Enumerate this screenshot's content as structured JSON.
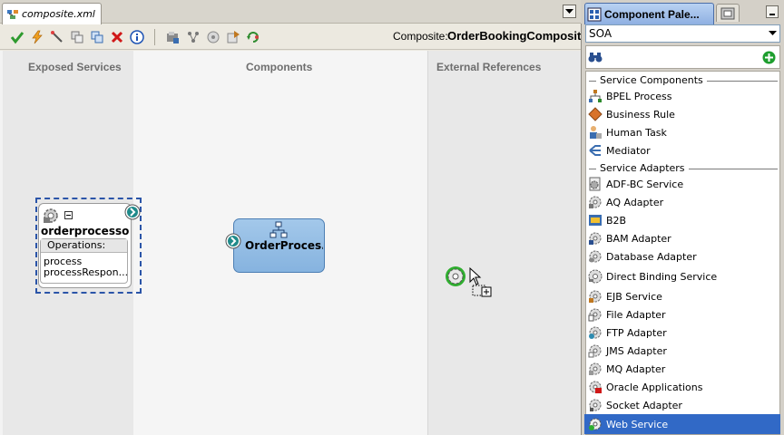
{
  "editor": {
    "tab_label": "composite.xml",
    "composite_label": "Composite:",
    "composite_name": "OrderBookingComposite",
    "toolbar_icons": [
      "validate-check-icon",
      "lightning-icon",
      "wand-icon",
      "copy-icon",
      "paste-icon",
      "delete-icon",
      "info-icon",
      "deploy-icon",
      "wiring-icon",
      "test-icon",
      "export-icon",
      "refresh-icon"
    ]
  },
  "lanes": {
    "exposed_services": "Exposed Services",
    "components": "Components",
    "external_references": "External References"
  },
  "exposed_service": {
    "name": "orderprocesso...",
    "operations_label": "Operations:",
    "operations": [
      "process",
      "processRespon..."
    ]
  },
  "component": {
    "name": "OrderProces..."
  },
  "palette": {
    "tab_label": "Component Pale...",
    "selected_category": "SOA",
    "sections": [
      {
        "title": "Service Components",
        "items": [
          "BPEL Process",
          "Business Rule",
          "Human Task",
          "Mediator"
        ]
      },
      {
        "title": "Service Adapters",
        "items": [
          "ADF-BC Service",
          "AQ Adapter",
          "B2B",
          "BAM Adapter",
          "Database Adapter",
          "Direct Binding Service",
          "EJB Service",
          "File Adapter",
          "FTP Adapter",
          "JMS Adapter",
          "MQ Adapter",
          "Oracle Applications",
          "Socket Adapter",
          "Web Service"
        ]
      }
    ],
    "selected_item": "Web Service"
  },
  "colors": {
    "selection_blue": "#3169c6",
    "component_fill": "#a3c8ea",
    "dashed_selection": "#2b55a8"
  }
}
